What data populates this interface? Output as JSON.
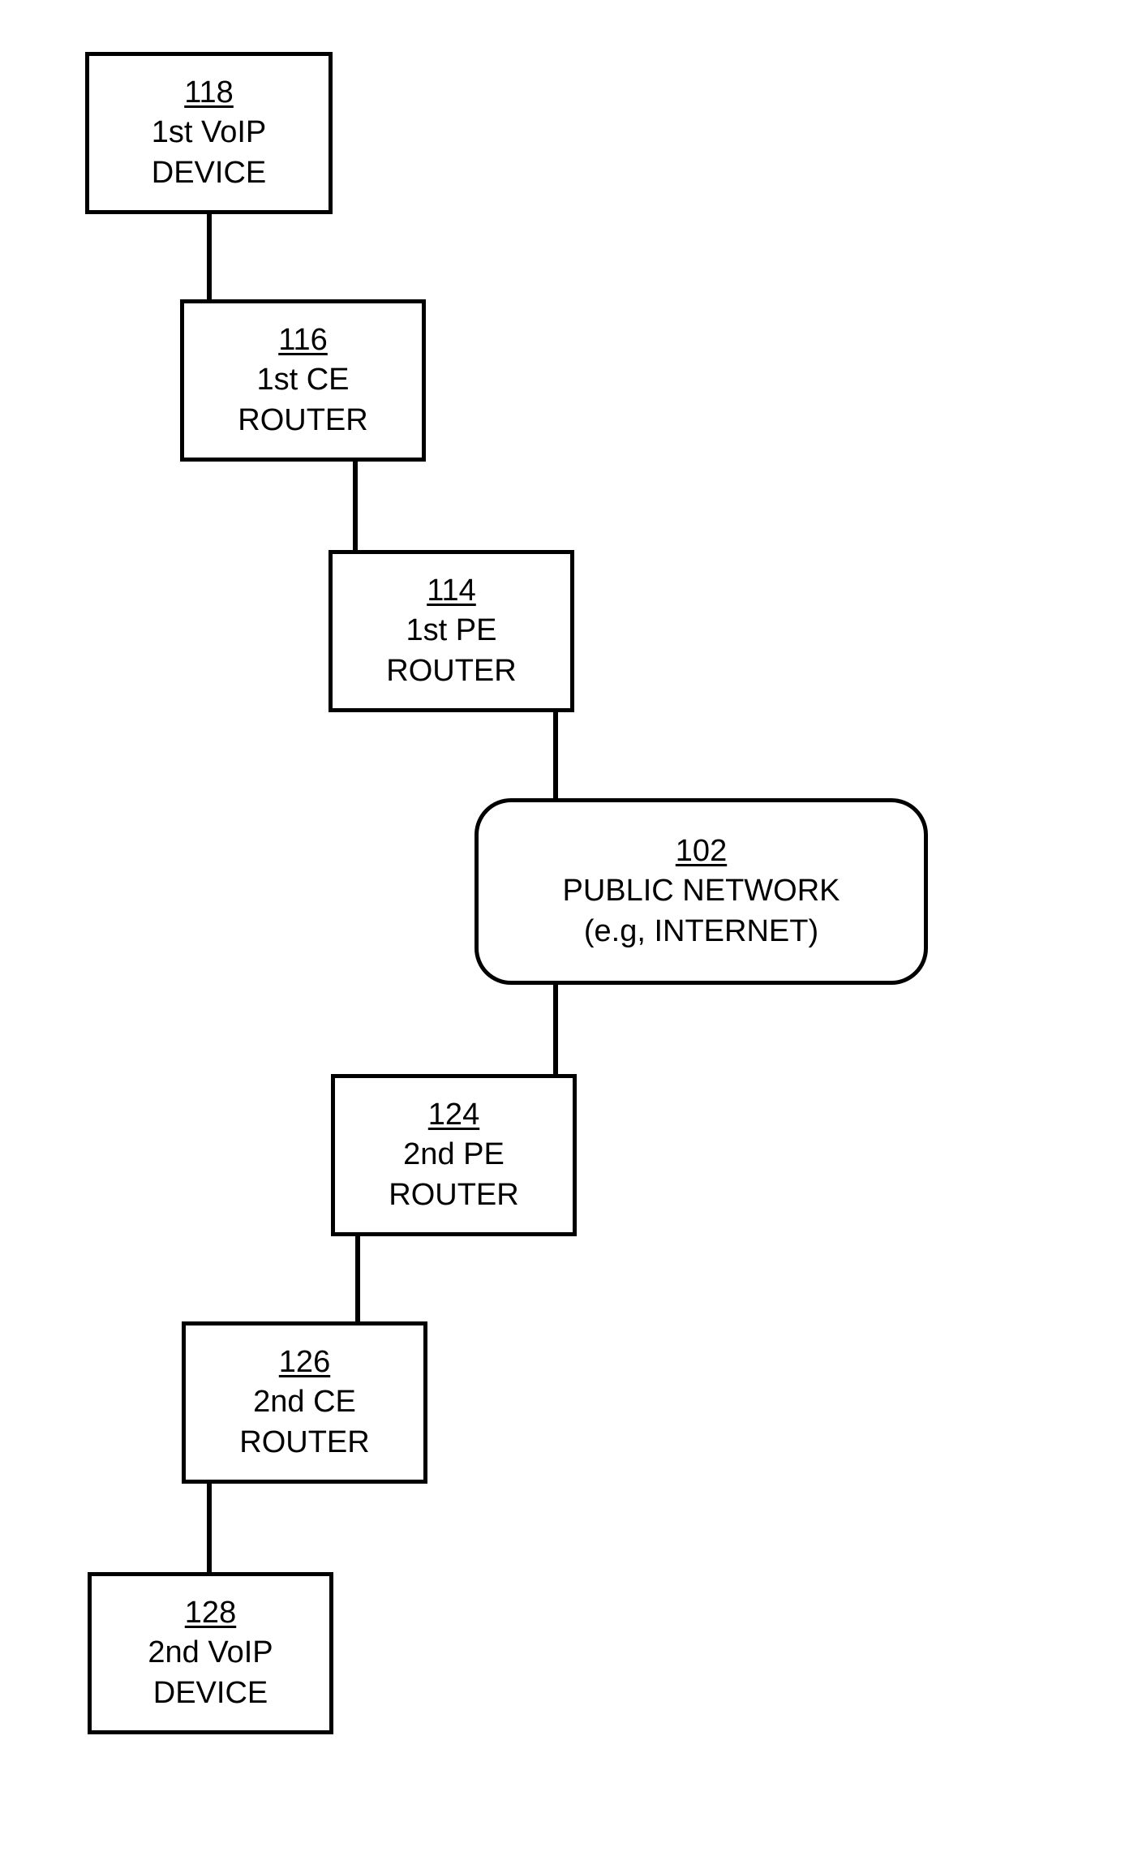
{
  "diagram": {
    "nodes": {
      "n1": {
        "ref": "118",
        "line1": "1st VoIP",
        "line2": "DEVICE"
      },
      "n2": {
        "ref": "116",
        "line1": "1st CE",
        "line2": "ROUTER"
      },
      "n3": {
        "ref": "114",
        "line1": "1st PE",
        "line2": "ROUTER"
      },
      "n4": {
        "ref": "102",
        "line1": "PUBLIC NETWORK",
        "line2": "(e.g, INTERNET)"
      },
      "n5": {
        "ref": "124",
        "line1": "2nd PE",
        "line2": "ROUTER"
      },
      "n6": {
        "ref": "126",
        "line1": "2nd CE",
        "line2": "ROUTER"
      },
      "n7": {
        "ref": "128",
        "line1": "2nd VoIP",
        "line2": "DEVICE"
      }
    }
  }
}
